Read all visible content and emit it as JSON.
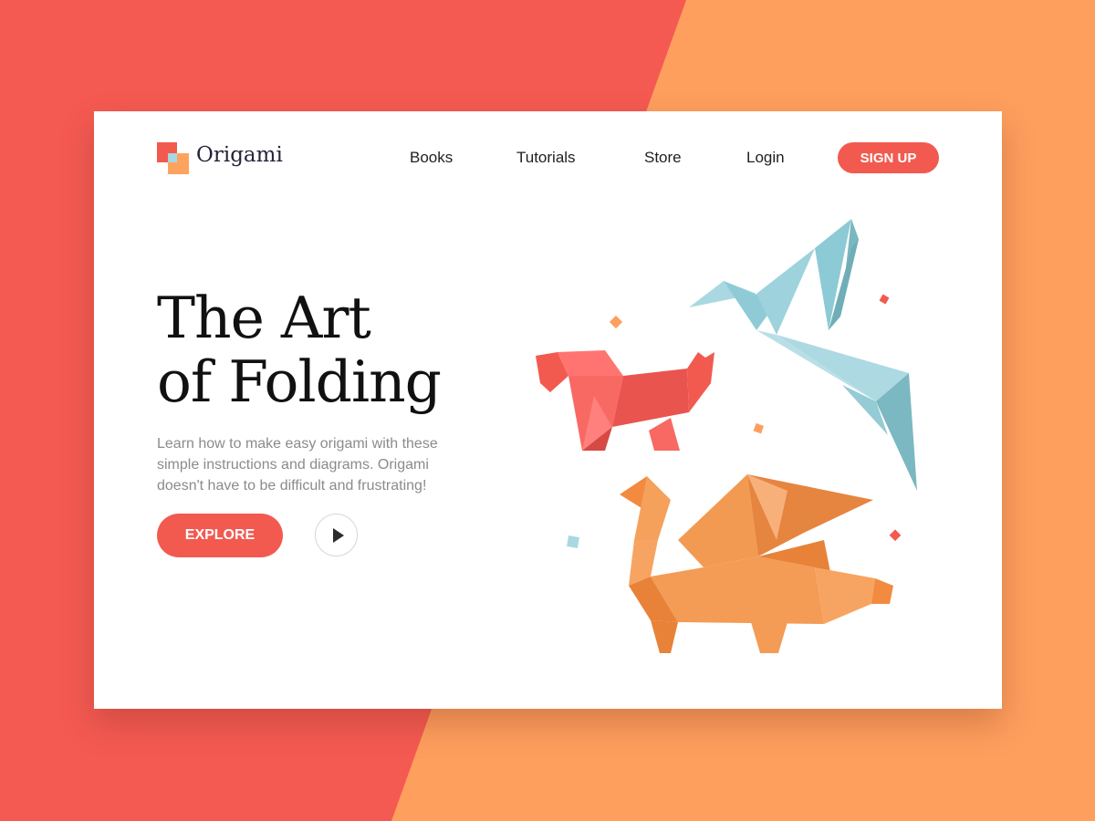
{
  "colors": {
    "background_left": "#f45a52",
    "background_right": "#fe9f5e",
    "accent": "#f25a50",
    "card": "#ffffff"
  },
  "brand": {
    "name": "Origami",
    "logo_icon": "origami-squares-logo-icon"
  },
  "nav": {
    "items": [
      "Books",
      "Tutorials",
      "Store",
      "Login"
    ],
    "signup_label": "SIGN UP"
  },
  "hero": {
    "title_line1": "The Art",
    "title_line2": "of Folding",
    "description_lines": [
      "Learn how to make easy origami with these",
      "simple instructions and diagrams. Origami",
      "doesn't have to be difficult and frustrating!"
    ],
    "explore_label": "EXPLORE",
    "play_icon": "play-icon"
  },
  "illustration": {
    "figures": [
      "origami-crane",
      "origami-dog",
      "origami-dragon"
    ]
  }
}
